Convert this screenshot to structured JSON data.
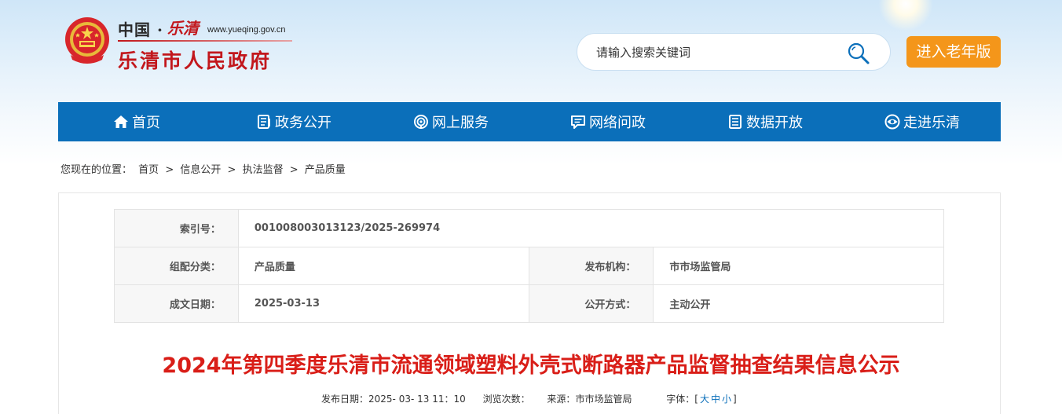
{
  "header": {
    "logo_cn": "中国 ·",
    "logo_calli": "乐清",
    "logo_url": "www.yueqing.gov.cn",
    "logo_name": "乐清市人民政府"
  },
  "search": {
    "placeholder": "请输入搜索关键词"
  },
  "elder_mode_label": "进入老年版",
  "nav": {
    "items": [
      {
        "label": "首页",
        "icon": "home-icon"
      },
      {
        "label": "政务公开",
        "icon": "document-icon"
      },
      {
        "label": "网上服务",
        "icon": "broadcast-icon"
      },
      {
        "label": "网络问政",
        "icon": "chat-icon"
      },
      {
        "label": "数据开放",
        "icon": "data-icon"
      },
      {
        "label": "走进乐清",
        "icon": "eye-icon"
      }
    ]
  },
  "breadcrumb": {
    "prefix": "您现在的位置：",
    "items": [
      "首页",
      "信息公开",
      "执法监督",
      "产品质量"
    ],
    "separator": ">"
  },
  "meta": {
    "index_label": "索引号：",
    "index_value": "001008003013123/2025-269974",
    "category_label": "组配分类：",
    "category_value": "产品质量",
    "publisher_label": "发布机构：",
    "publisher_value": "市市场监管局",
    "date_label": "成文日期：",
    "date_value": "2025-03-13",
    "disclosure_label": "公开方式：",
    "disclosure_value": "主动公开"
  },
  "article": {
    "title": "2024年第四季度乐清市流通领域塑料外壳式断路器产品监督抽查结果信息公示",
    "publish_label": "发布日期：",
    "publish_value": "2025- 03- 13 11：10",
    "views_label": "浏览次数：",
    "source_label": "来源：",
    "source_value": "市市场监管局",
    "font_label": "字体：[",
    "font_large": "大",
    "font_medium": "中",
    "font_small": "小",
    "font_close": "]"
  },
  "colors": {
    "nav_bg": "#0b6fba",
    "elder_btn": "#f4961a",
    "title_red": "#d91e18",
    "logo_red": "#c2171c"
  }
}
